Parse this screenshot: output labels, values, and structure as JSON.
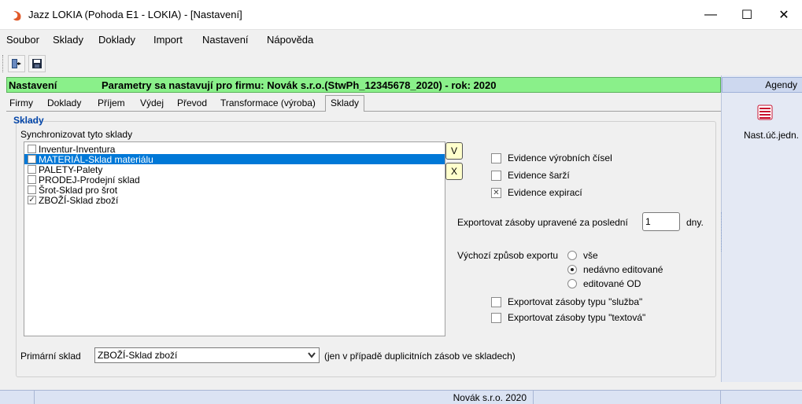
{
  "window": {
    "title": "Jazz LOKIA (Pohoda E1 - LOKIA) - [Nastavení]",
    "minimize": "—",
    "maximize": "☐",
    "close": "✕"
  },
  "menu": [
    {
      "label": "Soubor"
    },
    {
      "label": "Sklady"
    },
    {
      "label": "Doklady"
    },
    {
      "label": "Import"
    },
    {
      "label": "Nastavení"
    },
    {
      "label": "Nápověda"
    }
  ],
  "toolbar": {
    "icons": [
      "exit-icon",
      "save-icon"
    ]
  },
  "header": {
    "section": "Nastavení",
    "info": "Parametry sa nastavují pro firmu: Novák s.r.o.(StwPh_12345678_2020) - rok: 2020"
  },
  "tabs": [
    {
      "label": "Firmy"
    },
    {
      "label": "Doklady"
    },
    {
      "label": "Příjem"
    },
    {
      "label": "Výdej"
    },
    {
      "label": "Převod"
    },
    {
      "label": "Transformace (výroba)"
    },
    {
      "label": "Sklady"
    }
  ],
  "sklady": {
    "group_title": "Sklady",
    "sync_label": "Synchronizovat tyto sklady",
    "items": [
      {
        "label": "Inventur-Inventura",
        "checked": false,
        "selected": false
      },
      {
        "label": "MATERIÁL-Sklad materiálu",
        "checked": false,
        "selected": true
      },
      {
        "label": "PALETY-Palety",
        "checked": false,
        "selected": false
      },
      {
        "label": "PRODEJ-Prodejní sklad",
        "checked": false,
        "selected": false
      },
      {
        "label": "Šrot-Sklad pro šrot",
        "checked": false,
        "selected": false
      },
      {
        "label": "ZBOŽÍ-Sklad zboží",
        "checked": true,
        "selected": false
      }
    ],
    "btn_select_all": "V",
    "btn_clear_all": "X"
  },
  "options": {
    "evidence_vyrobnich_cisel": {
      "label": "Evidence výrobních čísel",
      "checked": false
    },
    "evidence_sarzi": {
      "label": "Evidence šarží",
      "checked": false
    },
    "evidence_expiraci": {
      "label": "Evidence expirací",
      "checked": true
    },
    "export_days_label": "Exportovat zásoby upravené za poslední",
    "export_days_value": "1",
    "export_days_unit": "dny.",
    "export_mode_label": "Výchozí způsob exportu",
    "export_modes": [
      {
        "label": "vše",
        "selected": false
      },
      {
        "label": "nedávno editované",
        "selected": true
      },
      {
        "label": "editované OD",
        "selected": false
      }
    ],
    "export_sluzba": {
      "label": "Exportovat zásoby typu \"služba\"",
      "checked": false
    },
    "export_textova": {
      "label": "Exportovat zásoby typu \"textová\"",
      "checked": false
    }
  },
  "primary": {
    "label": "Primární sklad",
    "value": "ZBOŽÍ-Sklad zboží",
    "note": "(jen v případě duplicitních zásob ve skladech)"
  },
  "agendy": {
    "title": "Agendy",
    "item_label": "Nast.úč.jedn."
  },
  "status": {
    "company": "Novák s.r.o. 2020"
  },
  "colors": {
    "header_bg": "#8af08a",
    "selection": "#0078d7",
    "group_title": "#0044a8"
  }
}
